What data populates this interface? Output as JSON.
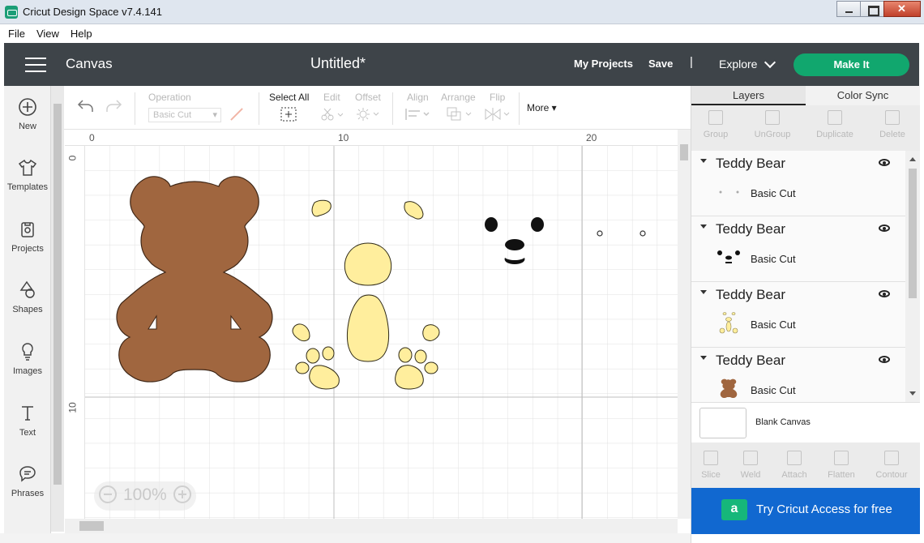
{
  "window": {
    "title": "Cricut Design Space  v7.4.141",
    "minimize_icon": "minimize-icon",
    "maximize_icon": "maximize-icon",
    "close_icon": "close-icon"
  },
  "menu": [
    "File",
    "View",
    "Help"
  ],
  "header": {
    "section": "Canvas",
    "doc_title": "Untitled*",
    "my_projects": "My Projects",
    "save": "Save",
    "separator": "|",
    "explore": "Explore",
    "make_it": "Make It",
    "make_it_color": "#11a76e",
    "header_color": "#3e4449"
  },
  "sidebar": {
    "items": [
      {
        "label": "New",
        "icon": "plus-circle-icon"
      },
      {
        "label": "Templates",
        "icon": "shirt-icon"
      },
      {
        "label": "Projects",
        "icon": "projects-icon"
      },
      {
        "label": "Shapes",
        "icon": "shapes-icon"
      },
      {
        "label": "Images",
        "icon": "lightbulb-icon"
      },
      {
        "label": "Text",
        "icon": "text-icon"
      },
      {
        "label": "Phrases",
        "icon": "speech-bubble-icon"
      }
    ]
  },
  "toolbar": {
    "operation_label": "Operation",
    "operation_value": "Basic Cut",
    "select_all": "Select All",
    "edit": "Edit",
    "offset": "Offset",
    "align": "Align",
    "arrange": "Arrange",
    "flip": "Flip",
    "more": "More"
  },
  "canvas": {
    "ruler_top": [
      "0",
      "10",
      "20"
    ],
    "ruler_left": [
      "0",
      "10"
    ],
    "zoom": "100%",
    "bear_body_color": "#a0663f",
    "bear_accent_color": "#ffee9d"
  },
  "panel": {
    "tabs": [
      "Layers",
      "Color Sync"
    ],
    "tools": [
      "Group",
      "UnGroup",
      "Duplicate",
      "Delete"
    ],
    "layers": [
      {
        "name": "Teddy Bear",
        "cut": "Basic Cut",
        "thumb": "dots"
      },
      {
        "name": "Teddy Bear",
        "cut": "Basic Cut",
        "thumb": "face"
      },
      {
        "name": "Teddy Bear",
        "cut": "Basic Cut",
        "thumb": "yellow"
      },
      {
        "name": "Teddy Bear",
        "cut": "Basic Cut",
        "thumb": "brown"
      }
    ],
    "blank_canvas": "Blank Canvas",
    "bottom_tools": [
      "Slice",
      "Weld",
      "Attach",
      "Flatten",
      "Contour"
    ],
    "access_label": "Try Cricut Access for free",
    "access_icon": "a"
  }
}
